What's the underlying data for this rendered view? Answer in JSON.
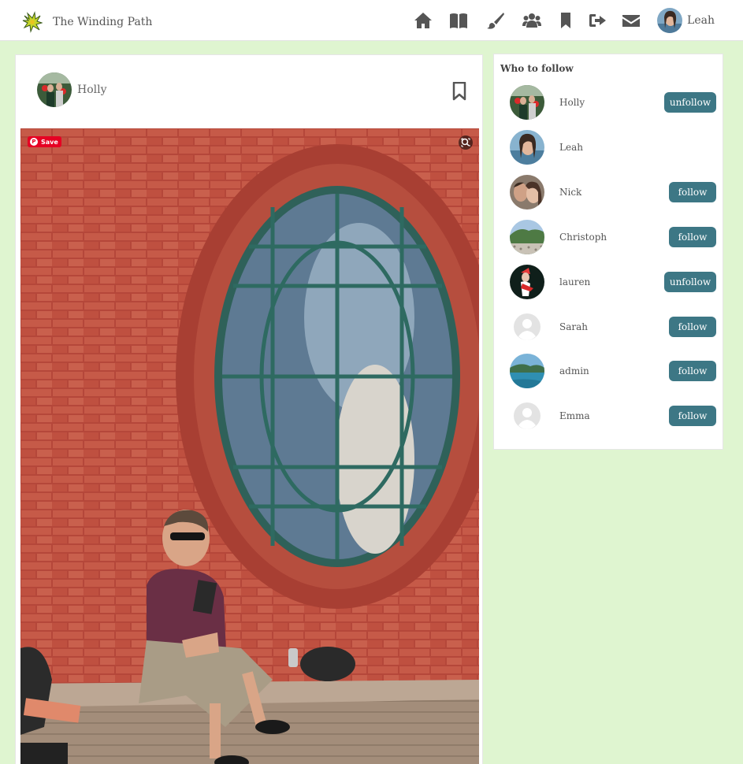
{
  "header": {
    "site_name": "The Winding Path",
    "nav_icons": [
      "home-icon",
      "book-icon",
      "paintbrush-icon",
      "users-icon",
      "bookmark-icon",
      "sign-out-icon",
      "envelope-icon"
    ],
    "user_name": "Leah"
  },
  "post": {
    "author": "Holly",
    "pinterest_save_label": "Save",
    "image_description_icons": [
      "pinterest-save-button",
      "visual-search-icon",
      "bookmark-icon"
    ]
  },
  "sidebar": {
    "title": "Who to follow",
    "users": [
      {
        "name": "Holly",
        "button": "unfollow"
      },
      {
        "name": "Leah",
        "button": ""
      },
      {
        "name": "Nick",
        "button": "follow"
      },
      {
        "name": "Christoph",
        "button": "follow"
      },
      {
        "name": "lauren",
        "button": "unfollow"
      },
      {
        "name": "Sarah",
        "button": "follow"
      },
      {
        "name": "admin",
        "button": "follow"
      },
      {
        "name": "Emma",
        "button": "follow"
      }
    ]
  },
  "colors": {
    "page_background": "#dff5d0",
    "button_teal": "#3d7785",
    "pinterest_red": "#e60023"
  }
}
